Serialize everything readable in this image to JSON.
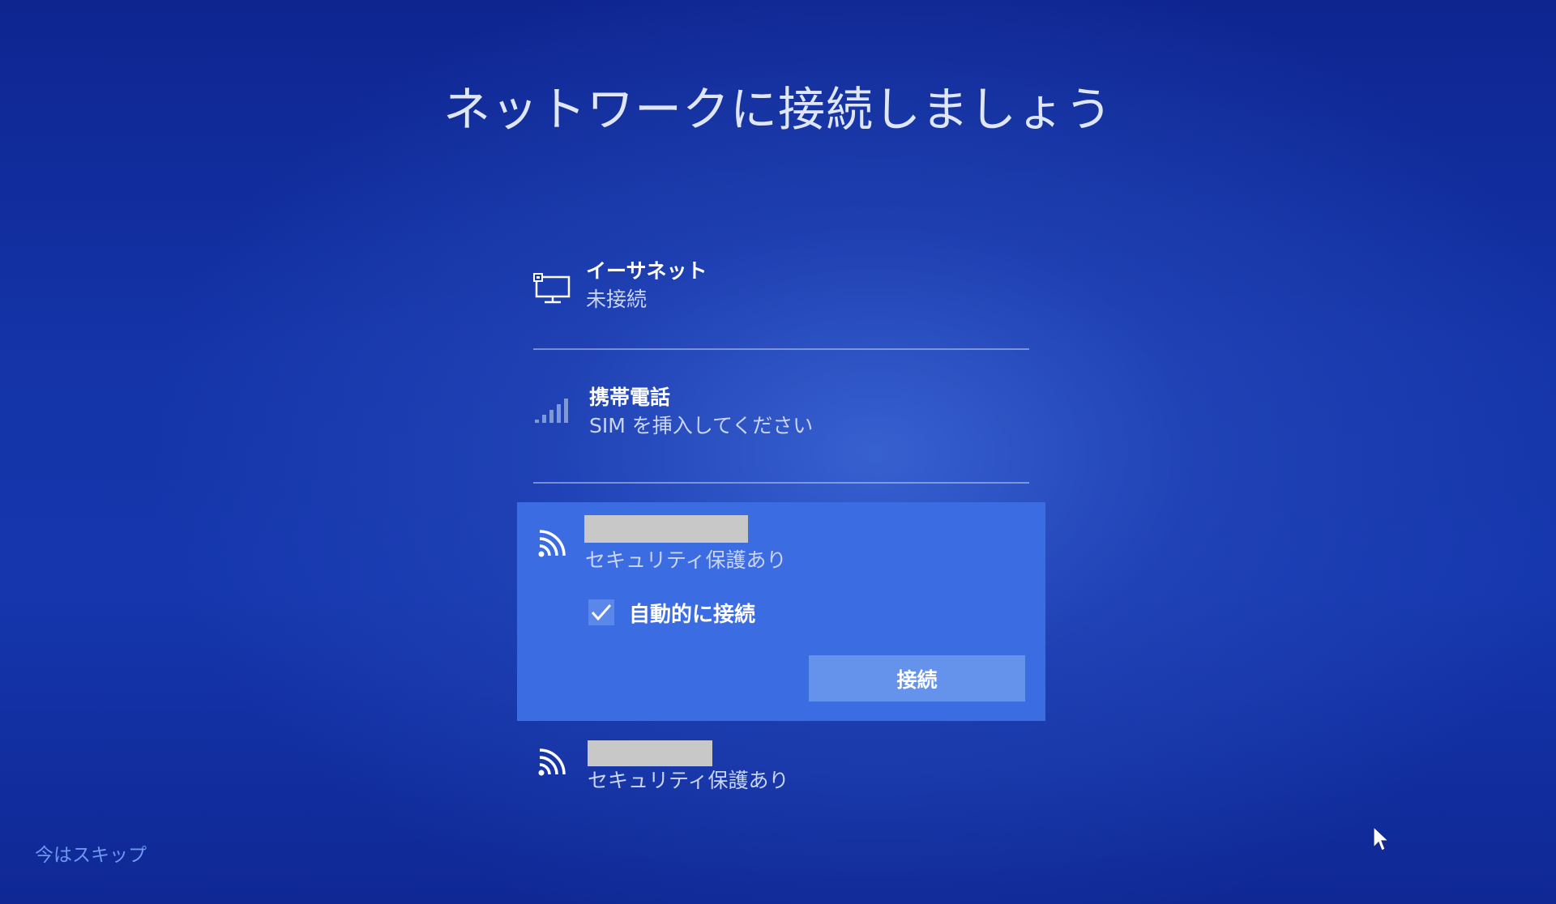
{
  "page": {
    "title": "ネットワークに接続しましょう"
  },
  "networks": {
    "ethernet": {
      "icon": "ethernet-icon",
      "name": "イーサネット",
      "status": "未接続"
    },
    "cellular": {
      "icon": "cellular-signal-icon",
      "name": "携帯電話",
      "status": "SIM を挿入してください"
    },
    "wifi_selected": {
      "icon": "wifi-icon",
      "name": "",
      "name_redacted": true,
      "status": "セキュリティ保護あり",
      "auto_connect_label": "自動的に接続",
      "auto_connect_checked": true,
      "connect_button_label": "接続"
    },
    "wifi_other": {
      "icon": "wifi-icon",
      "name": "",
      "name_redacted": true,
      "status": "セキュリティ保護あり"
    }
  },
  "footer": {
    "skip_label": "今はスキップ"
  },
  "colors": {
    "background": "#1434a8",
    "selected_panel": "#3c6ce2",
    "connect_button": "#6593ec",
    "skip_link": "#6f98f0",
    "redaction": "#c8c8c8"
  }
}
